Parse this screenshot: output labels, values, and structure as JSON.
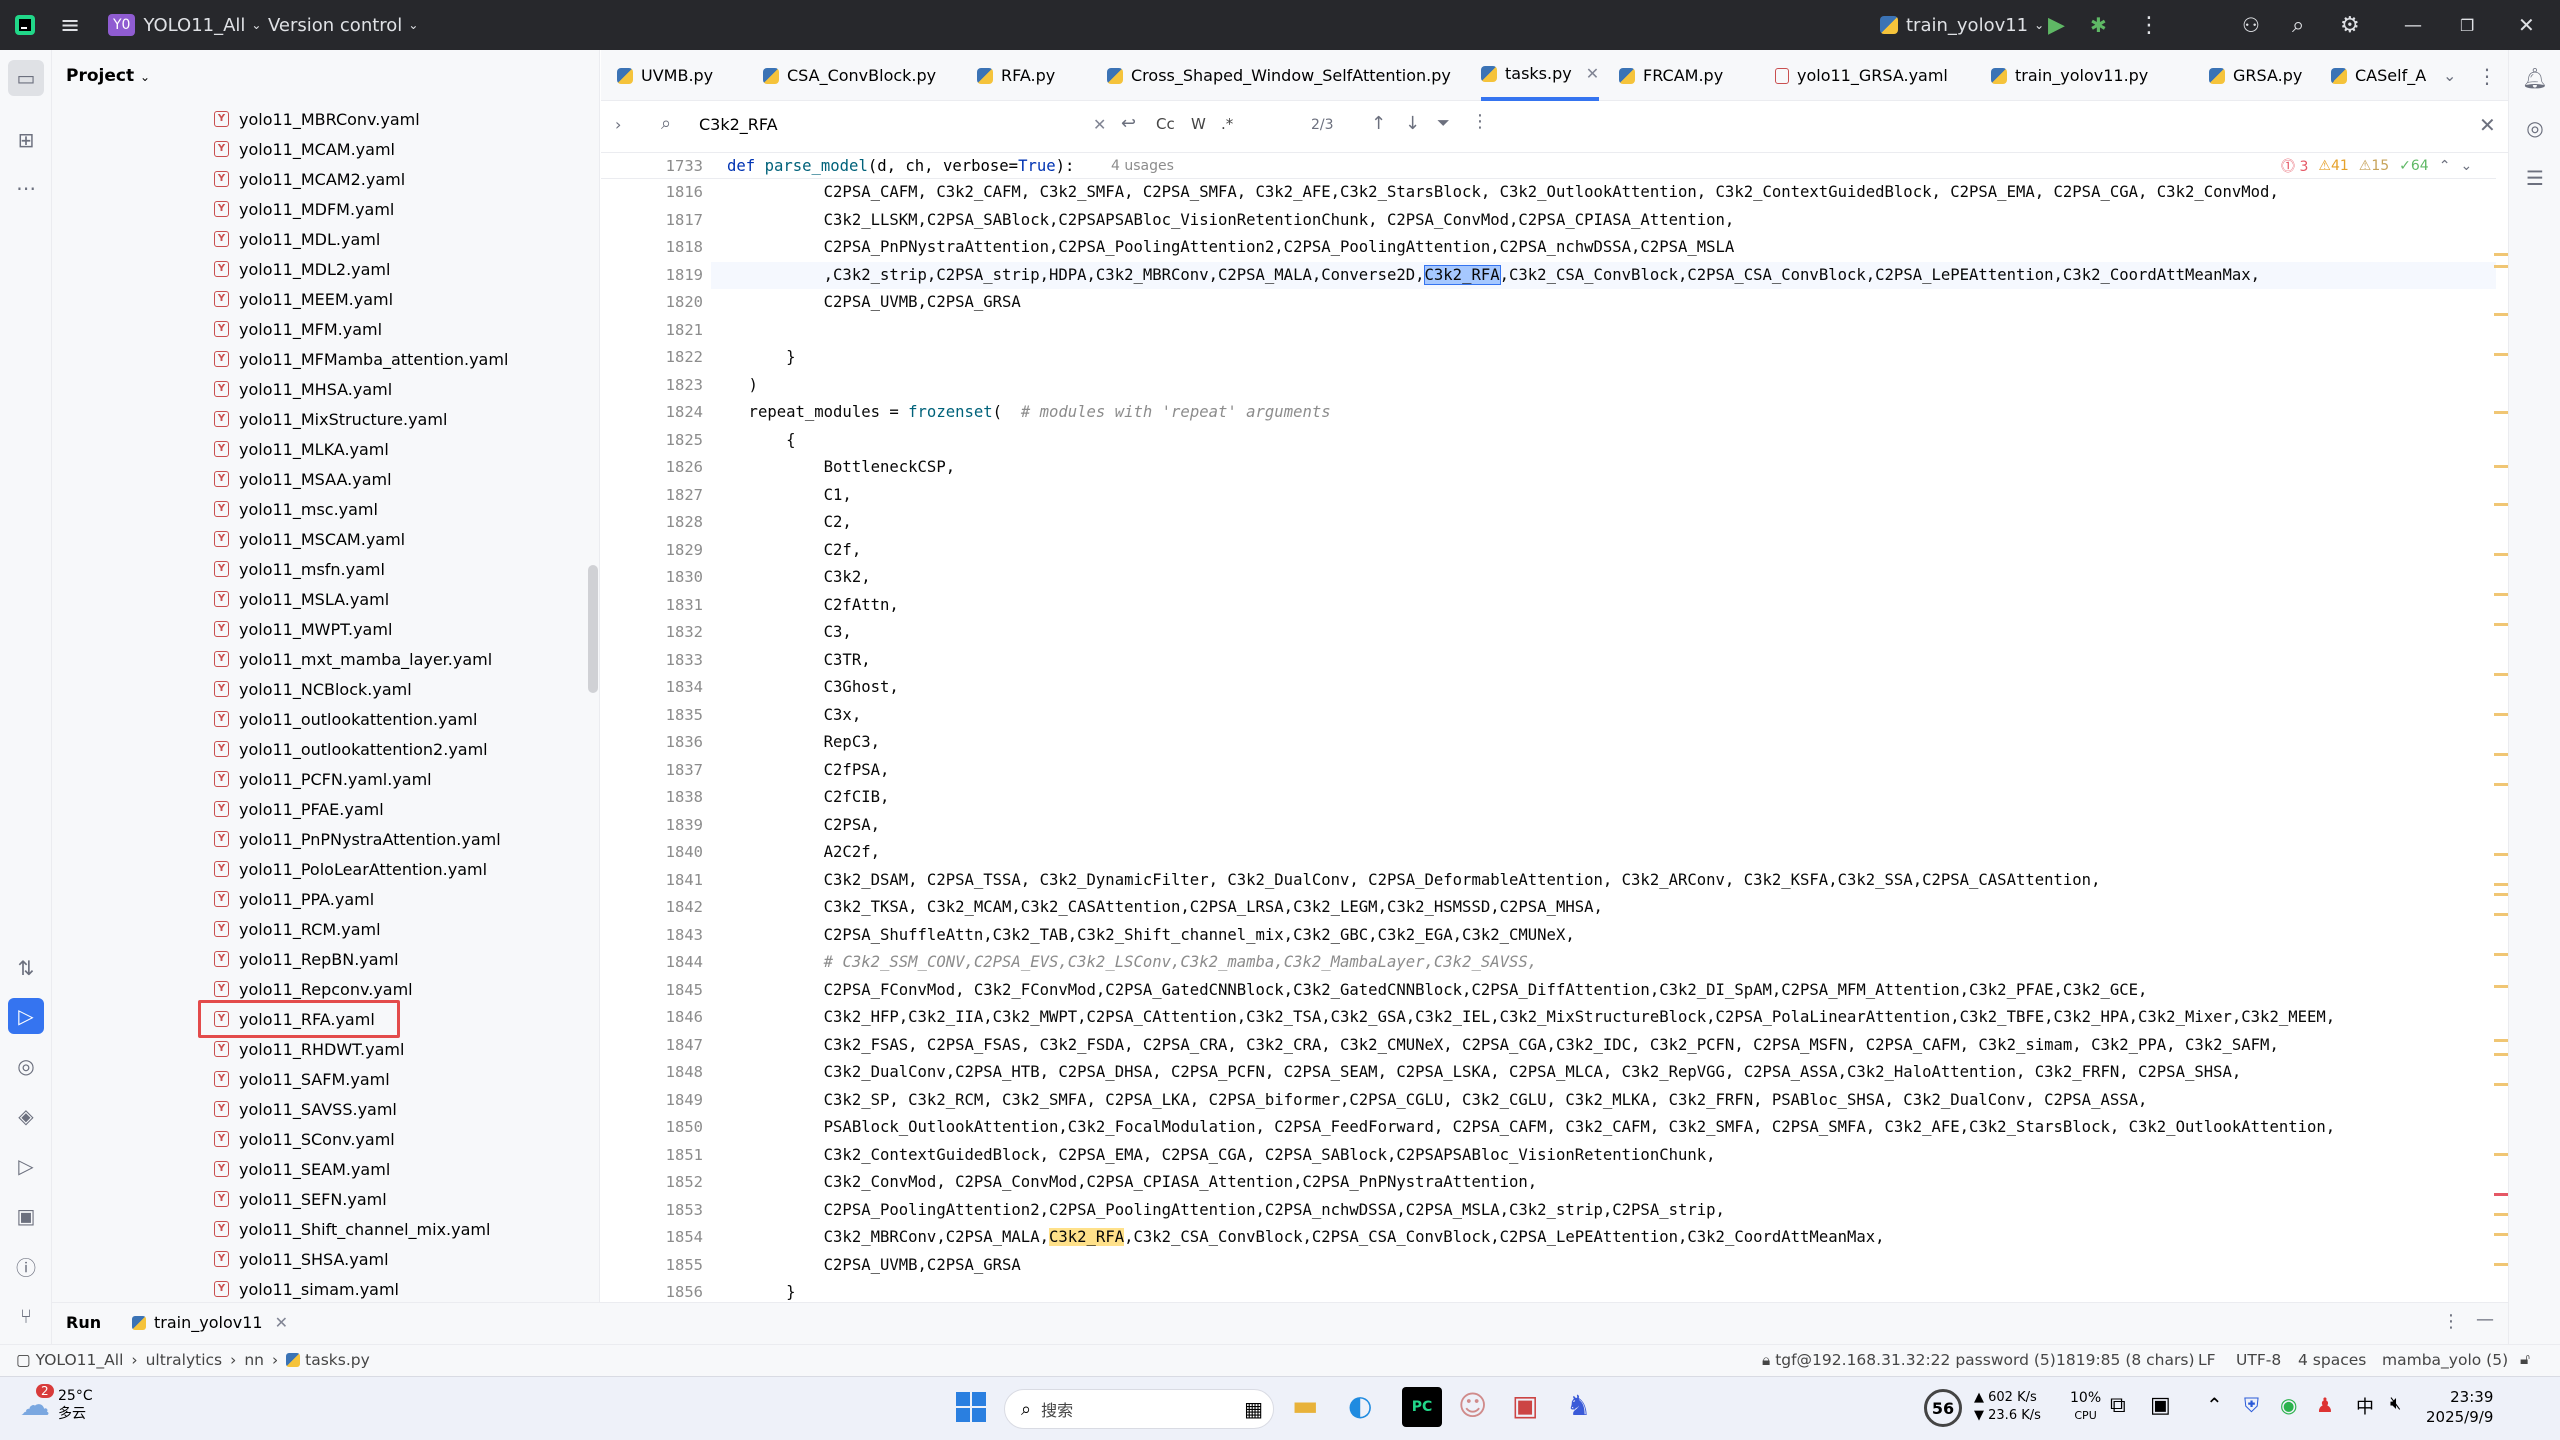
{
  "titlebar": {
    "project_badge": "Y0",
    "project_name": "YOLO11_All",
    "vcs": "Version control",
    "run_config": "train_yolov11"
  },
  "project_panel": {
    "title": "Project",
    "files": [
      "yolo11_MBRConv.yaml",
      "yolo11_MCAM.yaml",
      "yolo11_MCAM2.yaml",
      "yolo11_MDFM.yaml",
      "yolo11_MDL.yaml",
      "yolo11_MDL2.yaml",
      "yolo11_MEEM.yaml",
      "yolo11_MFM.yaml",
      "yolo11_MFMamba_attention.yaml",
      "yolo11_MHSA.yaml",
      "yolo11_MixStructure.yaml",
      "yolo11_MLKA.yaml",
      "yolo11_MSAA.yaml",
      "yolo11_msc.yaml",
      "yolo11_MSCAM.yaml",
      "yolo11_msfn.yaml",
      "yolo11_MSLA.yaml",
      "yolo11_MWPT.yaml",
      "yolo11_mxt_mamba_layer.yaml",
      "yolo11_NCBlock.yaml",
      "yolo11_outlookattention.yaml",
      "yolo11_outlookattention2.yaml",
      "yolo11_PCFN.yaml.yaml",
      "yolo11_PFAE.yaml",
      "yolo11_PnPNystraAttention.yaml",
      "yolo11_PoloLearAttention.yaml",
      "yolo11_PPA.yaml",
      "yolo11_RCM.yaml",
      "yolo11_RepBN.yaml",
      "yolo11_Repconv.yaml",
      "yolo11_RFA.yaml",
      "yolo11_RHDWT.yaml",
      "yolo11_SAFM.yaml",
      "yolo11_SAVSS.yaml",
      "yolo11_SConv.yaml",
      "yolo11_SEAM.yaml",
      "yolo11_SEFN.yaml",
      "yolo11_Shift_channel_mix.yaml",
      "yolo11_SHSA.yaml",
      "yolo11_simam.yaml"
    ]
  },
  "tabs": [
    "UVMB.py",
    "CSA_ConvBlock.py",
    "RFA.py",
    "Cross_Shaped_Window_SelfAttention.py",
    "tasks.py",
    "FRCAM.py",
    "yolo11_GRSA.yaml",
    "train_yolov11.py",
    "GRSA.py",
    "CASelf_A"
  ],
  "search": {
    "query": "C3k2_RFA",
    "cc": "Cc",
    "w": "W",
    "regex": ".*",
    "count": "2/3"
  },
  "sticky": {
    "line": "1733",
    "code": "def parse_model(d, ch, verbose=True):",
    "usages": "4 usages",
    "errors": "3",
    "warnings": "41",
    "weak": "15",
    "ok": "64"
  },
  "code_lines": [
    {
      "n": "1816",
      "t": "            C2PSA_CAFM, C3k2_CAFM, C3k2_SMFA, C2PSA_SMFA, C3k2_AFE,C3k2_StarsBlock, C3k2_OutlookAttention, C3k2_ContextGuidedBlock, C2PSA_EMA, C2PSA_CGA, C3k2_ConvMod,"
    },
    {
      "n": "1817",
      "t": "            C3k2_LLSKM,C2PSA_SABlock,C2PSAPSABloc_VisionRetentionChunk, C2PSA_ConvMod,C2PSA_CPIASA_Attention,"
    },
    {
      "n": "1818",
      "t": "            C2PSA_PnPNystraAttention,C2PSA_PoolingAttention2,C2PSA_PoolingAttention,C2PSA_nchwDSSA,C2PSA_MSLA"
    },
    {
      "n": "1819",
      "t": "            ,C3k2_strip,C2PSA_strip,HDPA,C3k2_MBRConv,C2PSA_MALA,Converse2D,C3k2_RFA,C3k2_CSA_ConvBlock,C2PSA_CSA_ConvBlock,C2PSA_LePEAttention,C3k2_CoordAttMeanMax,"
    },
    {
      "n": "1820",
      "t": "            C2PSA_UVMB,C2PSA_GRSA"
    },
    {
      "n": "1821",
      "t": ""
    },
    {
      "n": "1822",
      "t": "        }"
    },
    {
      "n": "1823",
      "t": "    )"
    },
    {
      "n": "1824",
      "t": "    repeat_modules = frozenset(  # modules with 'repeat' arguments"
    },
    {
      "n": "1825",
      "t": "        {"
    },
    {
      "n": "1826",
      "t": "            BottleneckCSP,"
    },
    {
      "n": "1827",
      "t": "            C1,"
    },
    {
      "n": "1828",
      "t": "            C2,"
    },
    {
      "n": "1829",
      "t": "            C2f,"
    },
    {
      "n": "1830",
      "t": "            C3k2,"
    },
    {
      "n": "1831",
      "t": "            C2fAttn,"
    },
    {
      "n": "1832",
      "t": "            C3,"
    },
    {
      "n": "1833",
      "t": "            C3TR,"
    },
    {
      "n": "1834",
      "t": "            C3Ghost,"
    },
    {
      "n": "1835",
      "t": "            C3x,"
    },
    {
      "n": "1836",
      "t": "            RepC3,"
    },
    {
      "n": "1837",
      "t": "            C2fPSA,"
    },
    {
      "n": "1838",
      "t": "            C2fCIB,"
    },
    {
      "n": "1839",
      "t": "            C2PSA,"
    },
    {
      "n": "1840",
      "t": "            A2C2f,"
    },
    {
      "n": "1841",
      "t": "            C3k2_DSAM, C2PSA_TSSA, C3k2_DynamicFilter, C3k2_DualConv, C2PSA_DeformableAttention, C3k2_ARConv, C3k2_KSFA,C3k2_SSA,C2PSA_CASAttention,"
    },
    {
      "n": "1842",
      "t": "            C3k2_TKSA, C3k2_MCAM,C3k2_CASAttention,C2PSA_LRSA,C3k2_LEGM,C3k2_HSMSSD,C2PSA_MHSA,"
    },
    {
      "n": "1843",
      "t": "            C2PSA_ShuffleAttn,C3k2_TAB,C3k2_Shift_channel_mix,C3k2_GBC,C3k2_EGA,C3k2_CMUNeX,"
    },
    {
      "n": "1844",
      "t": "            # C3k2_SSM_CONV,C2PSA_EVS,C3k2_LSConv,C3k2_mamba,C3k2_MambaLayer,C3k2_SAVSS,"
    },
    {
      "n": "1845",
      "t": "            C2PSA_FConvMod, C3k2_FConvMod,C2PSA_GatedCNNBlock,C3k2_GatedCNNBlock,C2PSA_DiffAttention,C3k2_DI_SpAM,C2PSA_MFM_Attention,C3k2_PFAE,C3k2_GCE,"
    },
    {
      "n": "1846",
      "t": "            C3k2_HFP,C3k2_IIA,C3k2_MWPT,C2PSA_CAttention,C3k2_TSA,C3k2_GSA,C3k2_IEL,C3k2_MixStructureBlock,C2PSA_PolaLinearAttention,C3k2_TBFE,C3k2_HPA,C3k2_Mixer,C3k2_MEEM,"
    },
    {
      "n": "1847",
      "t": "            C3k2_FSAS, C2PSA_FSAS, C3k2_FSDA, C2PSA_CRA, C3k2_CRA, C3k2_CMUNeX, C2PSA_CGA,C3k2_IDC, C3k2_PCFN, C2PSA_MSFN, C2PSA_CAFM, C3k2_simam, C3k2_PPA, C3k2_SAFM,"
    },
    {
      "n": "1848",
      "t": "            C3k2_DualConv,C2PSA_HTB, C2PSA_DHSA, C2PSA_PCFN, C2PSA_SEAM, C2PSA_LSKA, C2PSA_MLCA, C3k2_RepVGG, C2PSA_ASSA,C3k2_HaloAttention, C3k2_FRFN, C2PSA_SHSA,"
    },
    {
      "n": "1849",
      "t": "            C3k2_SP, C3k2_RCM, C3k2_SMFA, C2PSA_LKA, C2PSA_biformer,C2PSA_CGLU, C3k2_CGLU, C3k2_MLKA, C3k2_FRFN, PSABloc_SHSA, C3k2_DualConv, C2PSA_ASSA,"
    },
    {
      "n": "1850",
      "t": "            PSABlock_OutlookAttention,C3k2_FocalModulation, C2PSA_FeedForward, C2PSA_CAFM, C3k2_CAFM, C3k2_SMFA, C2PSA_SMFA, C3k2_AFE,C3k2_StarsBlock, C3k2_OutlookAttention,"
    },
    {
      "n": "1851",
      "t": "            C3k2_ContextGuidedBlock, C2PSA_EMA, C2PSA_CGA, C2PSA_SABlock,C2PSAPSABloc_VisionRetentionChunk,"
    },
    {
      "n": "1852",
      "t": "            C3k2_ConvMod, C2PSA_ConvMod,C2PSA_CPIASA_Attention,C2PSA_PnPNystraAttention,"
    },
    {
      "n": "1853",
      "t": "            C2PSA_PoolingAttention2,C2PSA_PoolingAttention,C2PSA_nchwDSSA,C2PSA_MSLA,C3k2_strip,C2PSA_strip,"
    },
    {
      "n": "1854",
      "t": "            C3k2_MBRConv,C2PSA_MALA,C3k2_RFA,C3k2_CSA_ConvBlock,C2PSA_CSA_ConvBlock,C2PSA_LePEAttention,C3k2_CoordAttMeanMax,"
    },
    {
      "n": "1855",
      "t": "            C2PSA_UVMB,C2PSA_GRSA"
    },
    {
      "n": "1856",
      "t": "        }"
    }
  ],
  "run_panel": {
    "title": "Run",
    "config": "train_yolov11"
  },
  "statusbar": {
    "crumbs": [
      "YOLO11_All",
      "ultralytics",
      "nn",
      "tasks.py"
    ],
    "remote": "tgf@192.168.31.32:22 password (5)",
    "position": "1819:85 (8 chars)",
    "line_sep": "LF",
    "encoding": "UTF-8",
    "indent": "4 spaces",
    "interpreter": "mamba_yolo (5)"
  },
  "taskbar": {
    "weather_badge": "2",
    "temp": "25°C",
    "weather": "多云",
    "search": "搜索",
    "perf_score": "56",
    "net_up": "602 K/s",
    "net_down": "23.6 K/s",
    "cpu": "10%",
    "cpu_label": "CPU",
    "ime": "中",
    "time": "23:39",
    "date": "2025/9/9"
  }
}
